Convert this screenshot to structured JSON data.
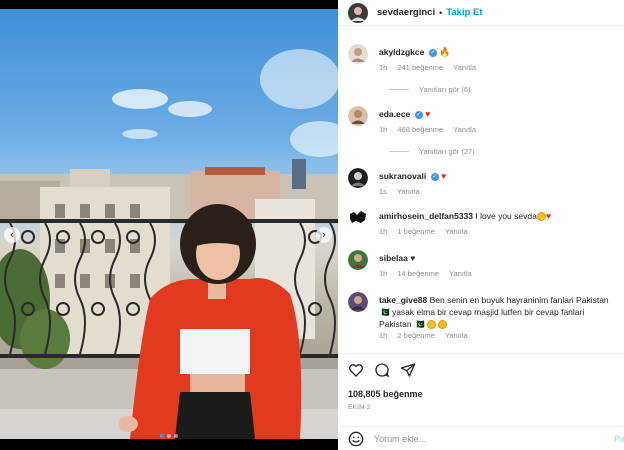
{
  "post": {
    "username": "sevdaerginci",
    "separator": "•",
    "follow_label": "Takip Et",
    "likes": "108,805 beğenme",
    "date": "EKİM 2"
  },
  "comments": [
    {
      "user": "akyldzgkce",
      "verified": true,
      "text": "",
      "emoji": "fire-emoji",
      "time": "1h",
      "likes": "241 beğenme",
      "reply": "Yanıtla",
      "view_replies": "Yanıtları gör (6)"
    },
    {
      "user": "eda.ece",
      "verified": true,
      "text": "",
      "emoji": "heart-emoji",
      "time": "1h",
      "likes": "468 beğenme",
      "reply": "Yanıtla",
      "view_replies": "Yanıtları gör (27)"
    },
    {
      "user": "sukranovali",
      "verified": true,
      "text": "",
      "emoji": "heart-emoji",
      "time": "1s",
      "reply": "Yanıtla"
    },
    {
      "user": "amirhosein_delfan5333",
      "verified": false,
      "text": "I love you sevda",
      "emoji": "face-heart-emoji",
      "time": "1h",
      "likes": "1 beğenme",
      "reply": "Yanıtla"
    },
    {
      "user": "sibelaa",
      "verified": false,
      "text": "♥",
      "time": "1h",
      "likes": "14 beğenme",
      "reply": "Yanıtla"
    },
    {
      "user": "take_give88",
      "verified": false,
      "text": "Ben senin en buyuk hayraninim fanlari Pakistan 🇵🇰 yasak elma bir cevap maşjid lutfen bir cevap fanlari Pakistan 🇵🇰",
      "time": "1h",
      "likes": "2 beğenme",
      "reply": "Yanıtla"
    }
  ],
  "comment_input": {
    "placeholder": "Yorum ekle...",
    "post_label": "Paylaş"
  },
  "icons": {
    "like": "heart-outline-icon",
    "comment": "speech-bubble-icon",
    "share": "paper-plane-icon",
    "emoji": "smiley-icon"
  },
  "colors": {
    "accent": "#0095f6",
    "verified": "#3897f0",
    "heart": "#ed2a3c",
    "muted": "#8e8e8e"
  }
}
